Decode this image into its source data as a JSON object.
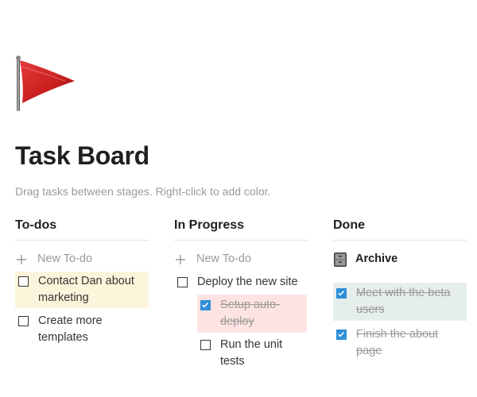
{
  "page": {
    "icon": "red-flag-icon",
    "title": "Task Board",
    "description": "Drag tasks between stages. Right-click to add color."
  },
  "columns": {
    "todo": {
      "title": "To-dos",
      "new_label": "New To-do",
      "items": [
        {
          "line1": "Contact Dan about",
          "line2": "marketing",
          "checked": false,
          "color": "#fdf4dc"
        },
        {
          "line1": "Create more",
          "line2": "templates",
          "checked": false
        }
      ]
    },
    "progress": {
      "title": "In Progress",
      "new_label": "New To-do",
      "items": [
        {
          "text": "Deploy the new site",
          "checked": false
        },
        {
          "line1": "Setup auto-",
          "line2": "deploy",
          "checked": true,
          "color": "#fde4e3"
        },
        {
          "line1": "Run the unit",
          "line2": "tests",
          "checked": false
        }
      ]
    },
    "done": {
      "title": "Done",
      "archive_icon": "file-cabinet-icon",
      "archive_label": "Archive",
      "items": [
        {
          "line1": "Meet with the beta",
          "line2": "users",
          "checked": true,
          "color": "#e6eeec"
        },
        {
          "line1": "Finish the about",
          "line2": "page",
          "checked": true
        }
      ]
    }
  },
  "colors": {
    "checkbox_checked": "#2e8fd8",
    "muted_text": "#9b9a97"
  }
}
